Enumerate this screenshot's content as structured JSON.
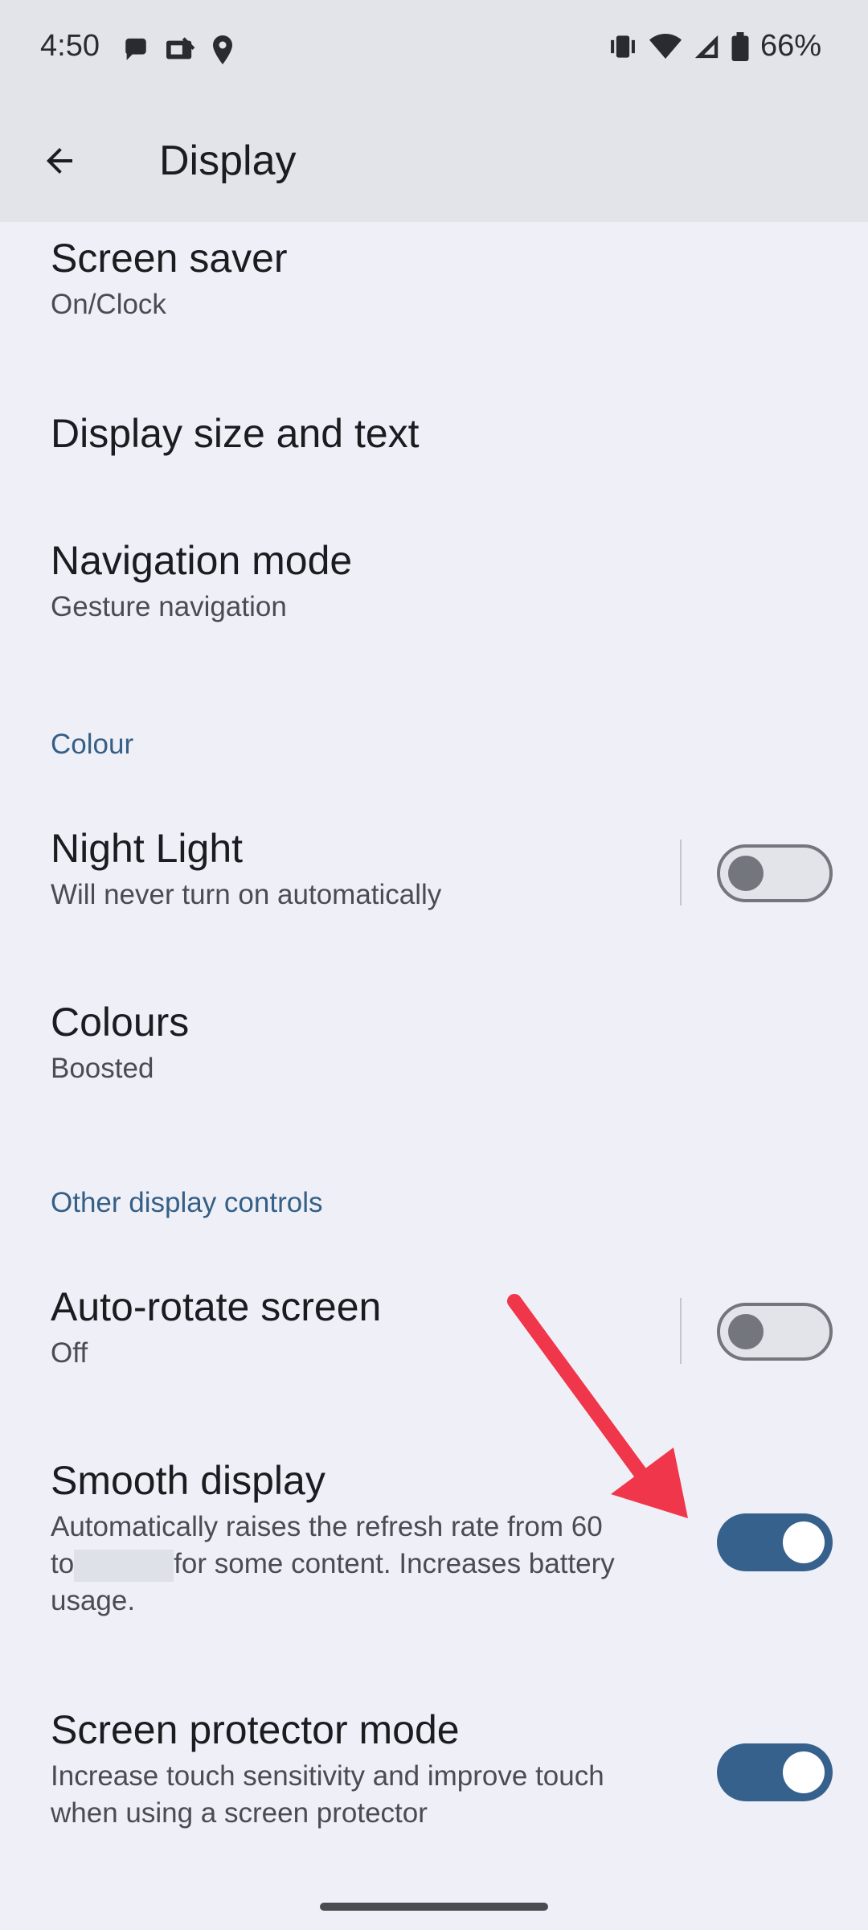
{
  "status_bar": {
    "time": "4:50",
    "battery": "66%",
    "left_icons": [
      "chat-bubble-icon",
      "photo-notification-icon",
      "location-pin-icon"
    ],
    "right_icons": [
      "vibrate-icon",
      "wifi-icon",
      "cellular-signal-icon",
      "battery-icon"
    ]
  },
  "app_bar": {
    "title": "Display",
    "back_icon": "back-arrow-icon"
  },
  "settings": {
    "screen_saver": {
      "title": "Screen saver",
      "subtitle": "On/Clock"
    },
    "display_size": {
      "title": "Display size and text"
    },
    "navigation_mode": {
      "title": "Navigation mode",
      "subtitle": "Gesture navigation"
    },
    "colour_header": "Colour",
    "night_light": {
      "title": "Night Light",
      "subtitle": "Will never turn on automatically",
      "toggle": "off"
    },
    "colours": {
      "title": "Colours",
      "subtitle": "Boosted"
    },
    "other_header": "Other display controls",
    "auto_rotate": {
      "title": "Auto-rotate screen",
      "subtitle": "Off",
      "toggle": "off"
    },
    "smooth_display": {
      "title": "Smooth display",
      "subtitle_part1": "Automatically raises the refresh rate from 60",
      "subtitle_part2": "to",
      "subtitle_part3": "for some content. Increases battery",
      "subtitle_part4": "usage.",
      "toggle": "on"
    },
    "screen_protector": {
      "title": "Screen protector mode",
      "subtitle": "Increase touch sensitivity and improve touch when using a screen protector",
      "toggle": "on"
    }
  },
  "colors": {
    "accent": "#37618d",
    "section_header": "#355f86",
    "annotation_arrow": "#f0364a"
  }
}
